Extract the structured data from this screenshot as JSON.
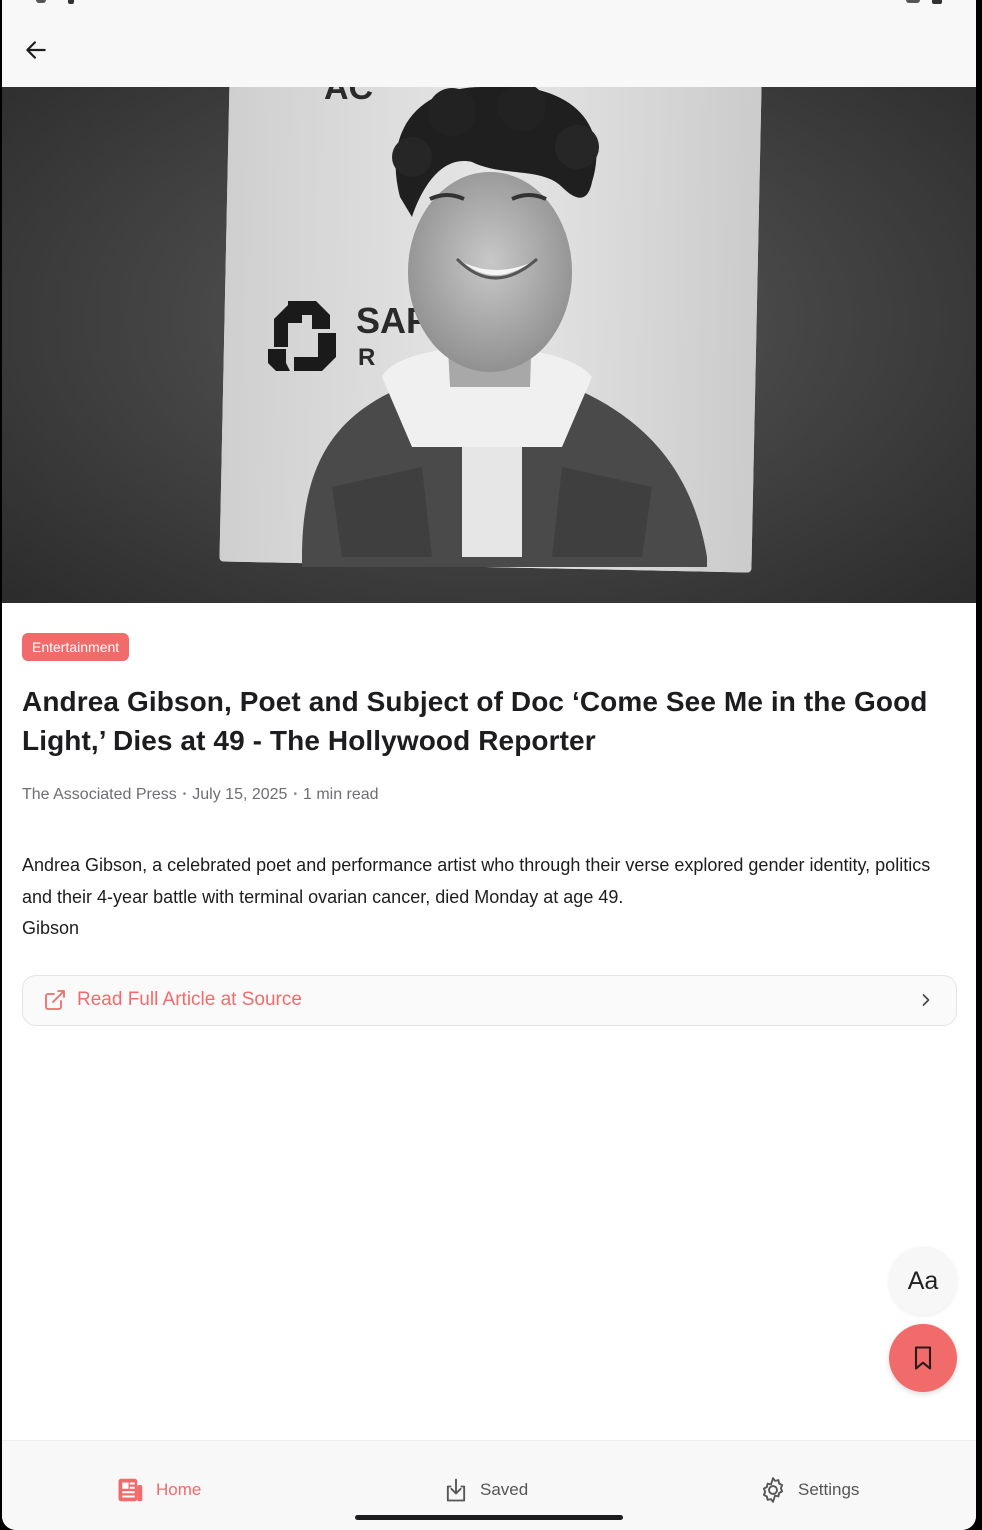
{
  "app_bar": {
    "back_icon": "arrow-left-icon"
  },
  "article": {
    "category": "Entertainment",
    "title": "Andrea Gibson, Poet and Subject of Doc ‘Come See Me in the Good Light,’ Dies at 49 - The Hollywood Reporter",
    "author": "The Associated Press",
    "date": "July 15, 2025",
    "read_time": "1 min read",
    "separator": "•",
    "body_line1": "Andrea Gibson, a celebrated poet and performance artist who through their verse explored gender identity, politics and their 4-year battle with terminal ovarian cancer, died Monday at age 49.",
    "body_line2": "Gibson"
  },
  "source_link": {
    "label": "Read Full Article at Source"
  },
  "fab": {
    "text_size_label": "Aa"
  },
  "bottom_nav": {
    "items": [
      {
        "label": "Home",
        "icon": "newspaper-icon",
        "active": true
      },
      {
        "label": "Saved",
        "icon": "download-icon",
        "active": false
      },
      {
        "label": "Settings",
        "icon": "gear-icon",
        "active": false
      }
    ]
  },
  "colors": {
    "accent": "#f26b6b",
    "text": "#1d1d1f",
    "muted": "#6e6e73"
  }
}
